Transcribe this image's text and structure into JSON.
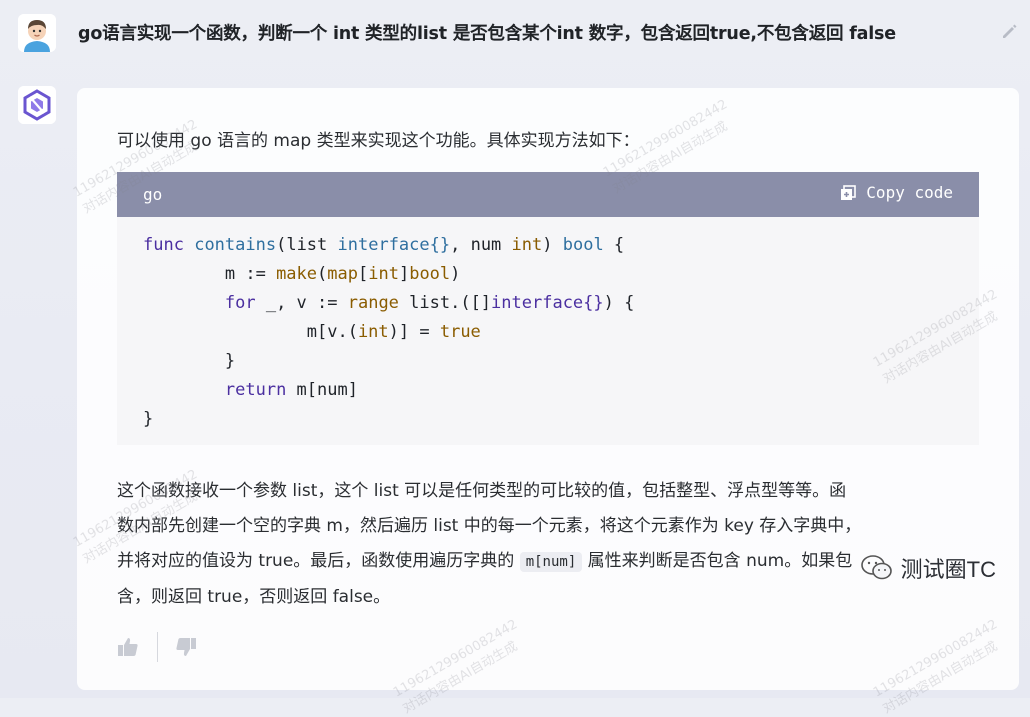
{
  "user_message": {
    "text": "go语言实现一个函数，判断一个 int 类型的list 是否包含某个int 数字，包含返回true,不包含返回 false"
  },
  "assistant": {
    "intro": "可以使用 go 语言的 map 类型来实现这个功能。具体实现方法如下：",
    "code_block": {
      "language": "go",
      "copy_label": "Copy code"
    },
    "paragraph_lines": [
      "这个函数接收一个参数 list，这个 list 可以是任何类型的可比较的值，包括整型、浮点型等等。函",
      "数内部先创建一个空的字典 m，然后遍历 list 中的每一个元素，将这个元素作为 key 存入字典中，",
      "并将对应的值设为 true。最后，函数使用遍历字典的 ",
      " 属性来判断是否包含 num。如果包",
      "含，则返回 true，否则返回 false。"
    ],
    "inline_code": "m[num]"
  },
  "code_lines": [
    [
      "func",
      " ",
      "contains",
      "(list ",
      "interface{}",
      ", num ",
      "int",
      ") ",
      "bool",
      " {"
    ],
    [
      "        m := ",
      "make",
      "(",
      "map",
      "[",
      "int",
      "]",
      "bool",
      ")"
    ],
    [
      "        ",
      "for",
      " _, v := ",
      "range",
      " list.([]",
      "interface{}",
      ") {"
    ],
    [
      "                m[v.(",
      "int",
      ")] = ",
      "true"
    ],
    [
      "        }"
    ],
    [
      "        ",
      "return",
      " m[num]"
    ],
    [
      "}"
    ]
  ],
  "watermarks": [
    "11962129960082442",
    "对话内容由AI自动生成"
  ],
  "brand": {
    "text": "测试圈TC"
  },
  "icons": [
    "user-avatar-icon",
    "edit-pencil-icon",
    "assistant-logo-icon",
    "copy-icon",
    "thumbs-up-icon",
    "thumbs-down-icon",
    "wechat-icon"
  ]
}
